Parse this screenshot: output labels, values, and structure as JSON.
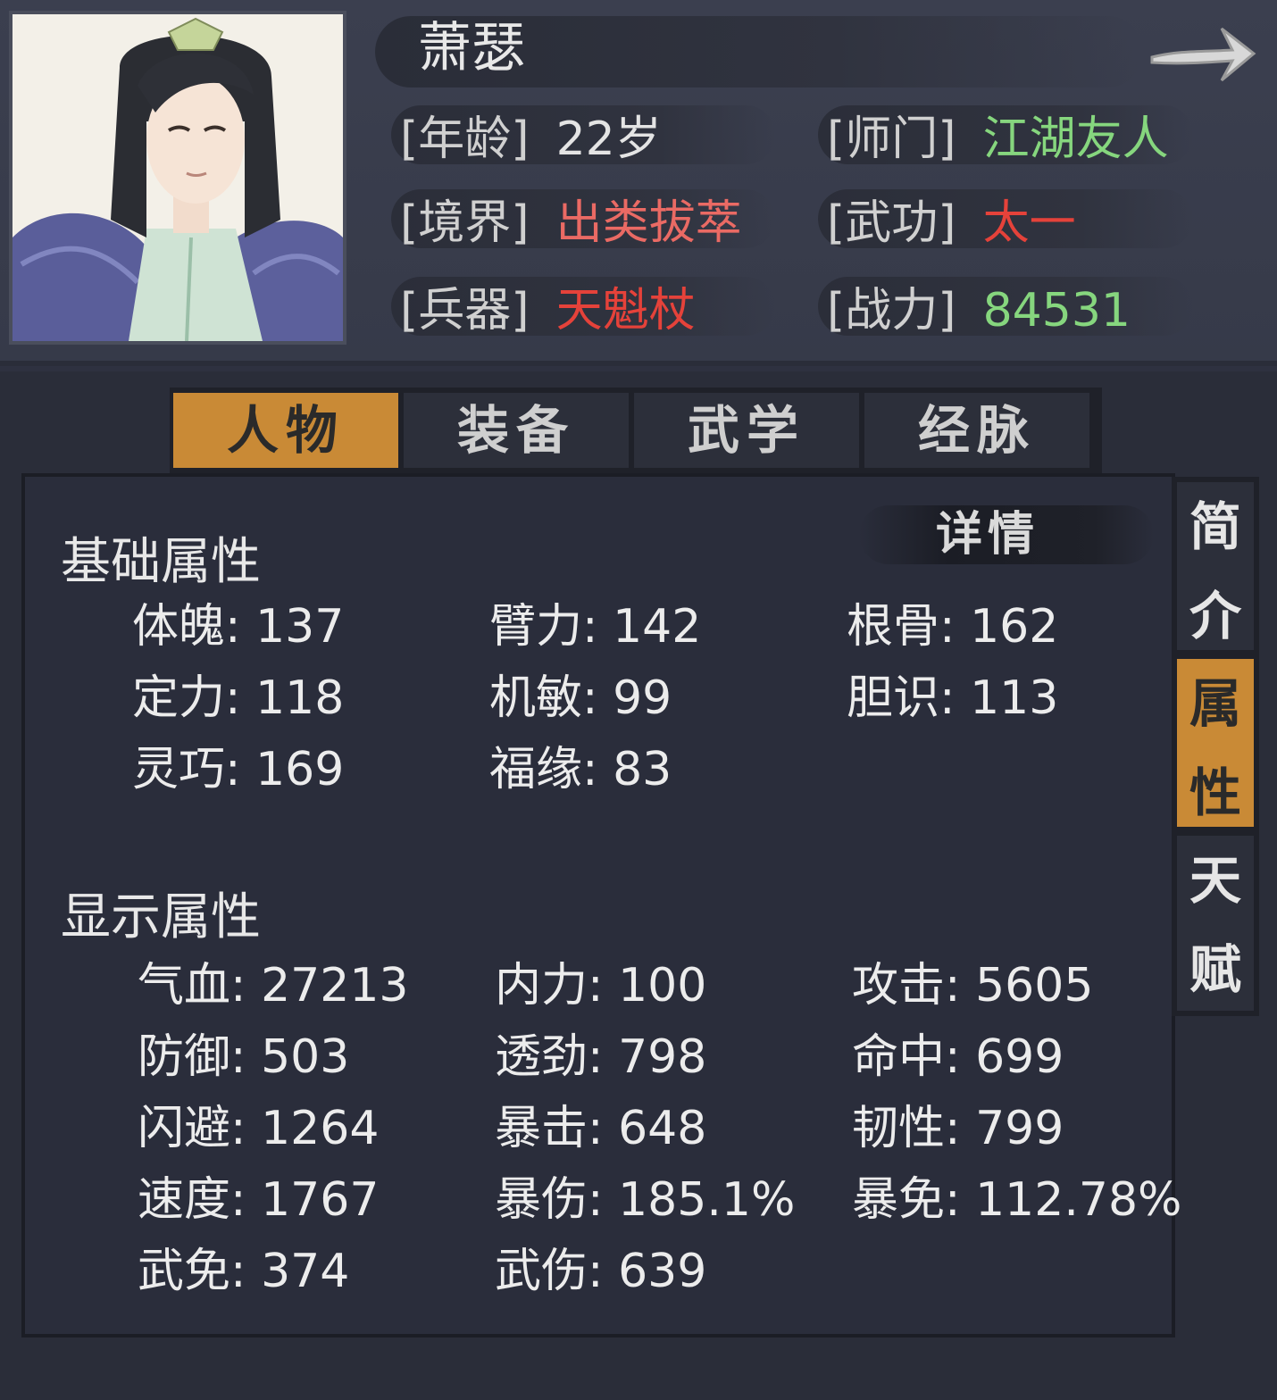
{
  "character": {
    "name": "萧瑟",
    "info": [
      {
        "key": "[年龄]",
        "value": "22岁",
        "color": "#e4e4e4"
      },
      {
        "key": "[师门]",
        "value": "江湖友人",
        "color": "#86d67e"
      },
      {
        "key": "[境界]",
        "value": "出类拔萃",
        "color": "#ea6a64"
      },
      {
        "key": "[武功]",
        "value": "太一",
        "color": "#e5423a"
      },
      {
        "key": "[兵器]",
        "value": "天魁杖",
        "color": "#e5423a"
      },
      {
        "key": "[战力]",
        "value": "84531",
        "color": "#86d67e"
      }
    ]
  },
  "tabs": [
    "人物",
    "装备",
    "武学",
    "经脉"
  ],
  "active_tab": "人物",
  "side_tabs": [
    {
      "label": [
        "简",
        "介"
      ]
    },
    {
      "label": [
        "属",
        "性"
      ]
    },
    {
      "label": [
        "天",
        "赋"
      ]
    }
  ],
  "active_side_tab": "属性",
  "detail_button": "详情",
  "basic": {
    "title": "基础属性",
    "stats": [
      {
        "label": "体魄",
        "value": "137"
      },
      {
        "label": "臂力",
        "value": "142"
      },
      {
        "label": "根骨",
        "value": "162"
      },
      {
        "label": "定力",
        "value": "118"
      },
      {
        "label": "机敏",
        "value": "99"
      },
      {
        "label": "胆识",
        "value": "113"
      },
      {
        "label": "灵巧",
        "value": "169"
      },
      {
        "label": "福缘",
        "value": "83"
      }
    ]
  },
  "display": {
    "title": "显示属性",
    "stats": [
      {
        "label": "气血",
        "value": "27213"
      },
      {
        "label": "内力",
        "value": "100"
      },
      {
        "label": "攻击",
        "value": "5605"
      },
      {
        "label": "防御",
        "value": "503"
      },
      {
        "label": "透劲",
        "value": "798"
      },
      {
        "label": "命中",
        "value": "699"
      },
      {
        "label": "闪避",
        "value": "1264"
      },
      {
        "label": "暴击",
        "value": "648"
      },
      {
        "label": "韧性",
        "value": "799"
      },
      {
        "label": "速度",
        "value": "1767"
      },
      {
        "label": "暴伤",
        "value": "185.1%"
      },
      {
        "label": "暴免",
        "value": "112.78%"
      },
      {
        "label": "武免",
        "value": "374"
      },
      {
        "label": "武伤",
        "value": "639"
      }
    ]
  },
  "colors": {
    "accent": "#c98a36",
    "green": "#86d67e",
    "red": "#e5423a",
    "pink": "#ea6a64"
  }
}
